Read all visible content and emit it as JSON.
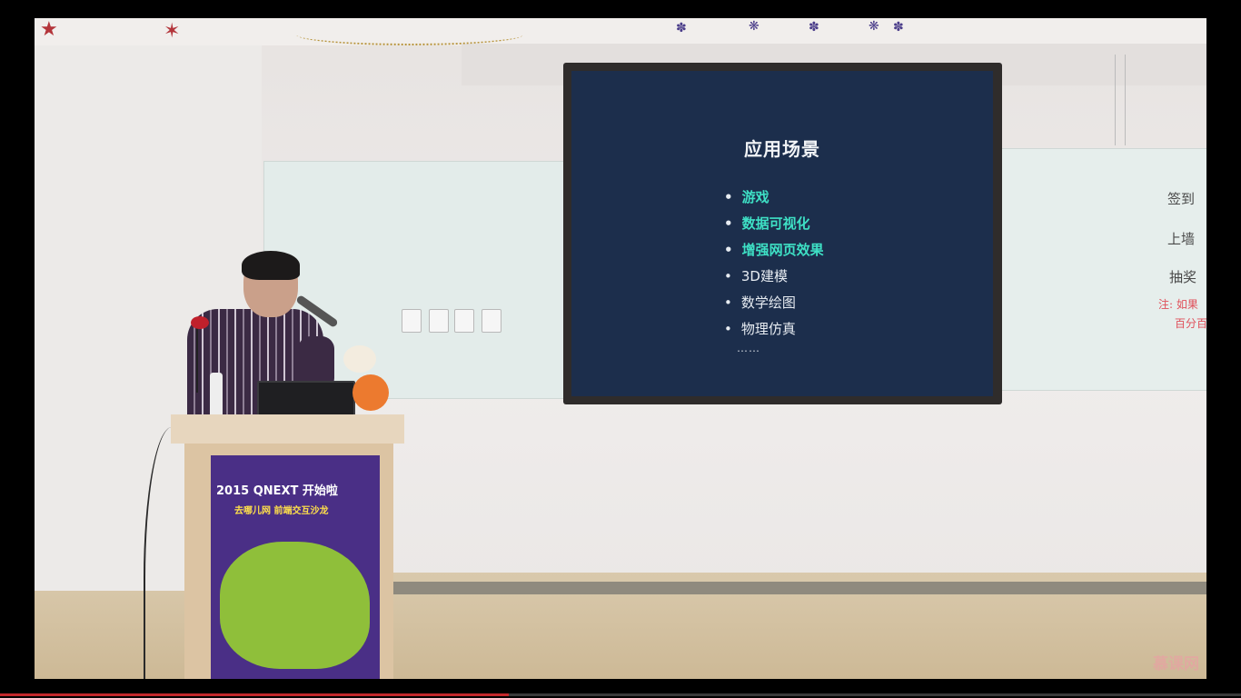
{
  "slide": {
    "title": "应用场景",
    "items": [
      {
        "text": "游戏",
        "highlighted": true
      },
      {
        "text": "数据可视化",
        "highlighted": true
      },
      {
        "text": "增强网页效果",
        "highlighted": true
      },
      {
        "text": "3D建模",
        "highlighted": false
      },
      {
        "text": "数学绘图",
        "highlighted": false
      },
      {
        "text": "物理仿真",
        "highlighted": false
      }
    ],
    "ellipsis": "……",
    "colors": {
      "background": "#1c2e4c",
      "highlight": "#3ee0c5",
      "text": "#e7ecf2"
    }
  },
  "whiteboard": {
    "notes": [
      "签到",
      "上墙",
      "抽奖"
    ],
    "red_notes": [
      "注: 如果",
      "百分百"
    ]
  },
  "banner": {
    "headline": "2015 QNEXT 开始啦",
    "subline": "去哪儿网 前端交互沙龙"
  },
  "watermark": "慕课网",
  "video": {
    "progress": 0.41,
    "progress_color": "#c3272b"
  }
}
